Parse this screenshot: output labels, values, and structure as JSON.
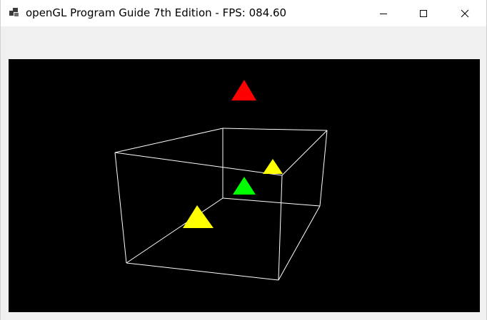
{
  "window": {
    "title": "openGL Program Guide 7th Edition - FPS: 084.60",
    "controls": {
      "minimize": "minimize",
      "maximize": "maximize",
      "close": "close"
    }
  },
  "scene": {
    "background": "#000000",
    "wireframe_color": "#ffffff",
    "triangle_colors": {
      "red": "#ff0000",
      "green": "#00ff00",
      "yellow": "#ffff00"
    }
  }
}
